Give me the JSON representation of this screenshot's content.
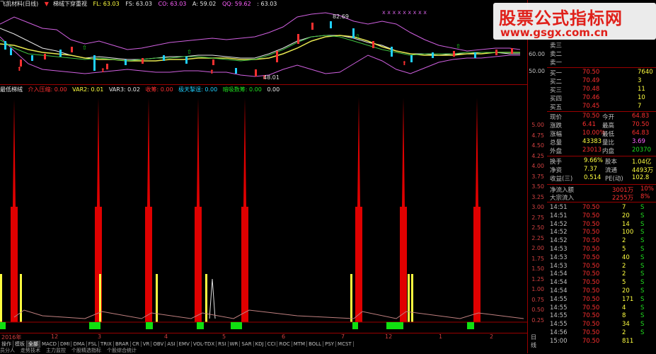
{
  "title_bar": {
    "stock": "飞凯材料(日线)",
    "formula": "梯绒下穿重视",
    "fl": "FL: 63.03",
    "fs": "FS: 63.03",
    "co": "CO: 63.03",
    "a": "A: 59.02",
    "qq": "QQ: 59.62",
    "last": ": 63.03"
  },
  "upper_chart": {
    "high_label": "82.69",
    "low_label": "48.01",
    "ask_labels": [
      "卖三",
      "卖二",
      "卖一"
    ],
    "price_ticks": [
      "60.00",
      "50.00"
    ]
  },
  "indicator_bar": {
    "name": "最低梯绒",
    "buy": "介入压缩: 0.00",
    "var2": "VAR2: 0.01",
    "var3": "VAR3: 0.02",
    "collect": "收筹: 0.00",
    "sky": "极天掣逞: 0.00",
    "flag": "暗吸数筹: 0.00",
    "tail": "0.00"
  },
  "lower_ticks": [
    "5.00",
    "4.75",
    "4.50",
    "4.25",
    "4.00",
    "3.75",
    "3.50",
    "3.25",
    "3.00",
    "2.75",
    "2.50",
    "2.25",
    "2.00",
    "1.75",
    "1.50",
    "1.25",
    "1.00",
    "0.75",
    "0.50",
    "0.25"
  ],
  "date_bar": {
    "labels": [
      "2016年",
      "12",
      "3",
      "4",
      "5",
      "6",
      "7",
      "12",
      "1",
      "2"
    ],
    "period": "日线"
  },
  "tabs": [
    "操作",
    "模板",
    "全部",
    "MACD",
    "DMI",
    "DMA",
    "FSL",
    "TRIX",
    "BRAR",
    "CR",
    "VR",
    "OBV",
    "ASI",
    "EMV",
    "VOL-TDX",
    "RSI",
    "WR",
    "SAR",
    "KDJ",
    "CCI",
    "ROC",
    "MTM",
    "BOLL",
    "PSY",
    "MCST"
  ],
  "tabs_active": "全部",
  "tabs2": [
    "员分人",
    "走势技术",
    "主力监控",
    "个股精选指标",
    "个股综合统计"
  ],
  "quote": {
    "bid": [
      {
        "label": "买一",
        "price": "70.50",
        "vol": "7640"
      },
      {
        "label": "买二",
        "price": "70.49",
        "vol": "3"
      },
      {
        "label": "买三",
        "price": "70.48",
        "vol": "11"
      },
      {
        "label": "买四",
        "price": "70.46",
        "vol": "10"
      },
      {
        "label": "买五",
        "price": "70.45",
        "vol": "7"
      }
    ],
    "stats": [
      {
        "l1": "现价",
        "v1": "70.50",
        "l2": "今开",
        "v2": "64.83"
      },
      {
        "l1": "涨跌",
        "v1": "6.41",
        "l2": "最高",
        "v2": "70.50"
      },
      {
        "l1": "涨幅",
        "v1": "10.00%",
        "l2": "最低",
        "v2": "64.83"
      },
      {
        "l1": "总量",
        "v1": "43383",
        "l2": "量比",
        "v2": "3.69"
      },
      {
        "l1": "外盘",
        "v1": "23013",
        "l2": "内盘",
        "v2": "20370"
      }
    ],
    "stats2": [
      {
        "l1": "换手",
        "v1": "9.66%",
        "l2": "股本",
        "v2": "1.04亿"
      },
      {
        "l1": "净资",
        "v1": "7.37",
        "l2": "流通",
        "v2": "4493万"
      },
      {
        "l1": "收益(三)",
        "v1": "0.514",
        "l2": "PE(动)",
        "v2": "102.8"
      }
    ],
    "flows": [
      {
        "label": "净流入额",
        "v": "3001万",
        "p": "10%"
      },
      {
        "label": "大宗流入",
        "v": "2255万",
        "p": "8%"
      }
    ],
    "ticks": [
      {
        "t": "14:51",
        "p": "70.50",
        "v": "7",
        "s": "S"
      },
      {
        "t": "14:51",
        "p": "70.50",
        "v": "20",
        "s": "S"
      },
      {
        "t": "14:52",
        "p": "70.50",
        "v": "14",
        "s": "S"
      },
      {
        "t": "14:52",
        "p": "70.50",
        "v": "100",
        "s": "S"
      },
      {
        "t": "14:52",
        "p": "70.50",
        "v": "2",
        "s": "S"
      },
      {
        "t": "14:53",
        "p": "70.50",
        "v": "5",
        "s": "S"
      },
      {
        "t": "14:53",
        "p": "70.50",
        "v": "40",
        "s": "S"
      },
      {
        "t": "14:53",
        "p": "70.50",
        "v": "2",
        "s": "S"
      },
      {
        "t": "14:54",
        "p": "70.50",
        "v": "2",
        "s": "S"
      },
      {
        "t": "14:54",
        "p": "70.50",
        "v": "5",
        "s": "S"
      },
      {
        "t": "14:54",
        "p": "70.50",
        "v": "20",
        "s": "S"
      },
      {
        "t": "14:55",
        "p": "70.50",
        "v": "171",
        "s": "S"
      },
      {
        "t": "14:55",
        "p": "70.50",
        "v": "4",
        "s": "S"
      },
      {
        "t": "14:55",
        "p": "70.50",
        "v": "8",
        "s": "S"
      },
      {
        "t": "14:55",
        "p": "70.50",
        "v": "34",
        "s": "S"
      },
      {
        "t": "14:56",
        "p": "70.50",
        "v": "2",
        "s": "S"
      },
      {
        "t": "15:00",
        "p": "70.50",
        "v": "811",
        "s": ""
      }
    ]
  },
  "watermark": {
    "title": "股票公式指标网",
    "url": "www.gsgx.com.cn"
  },
  "colors": {
    "up": "#ff3030",
    "down": "#20d0ff",
    "bar_red": "#e00000",
    "bar_yellow": "#ffff40",
    "bar_green": "#10e010",
    "grid": "#9a0000"
  }
}
